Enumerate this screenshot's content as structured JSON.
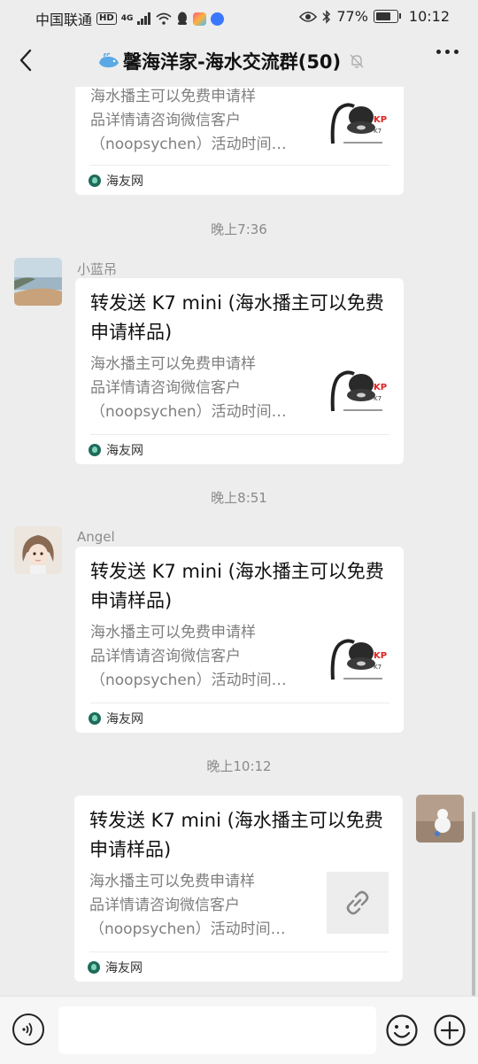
{
  "status_bar": {
    "carrier": "中国联通",
    "hd": "HD",
    "network": "4G",
    "battery": "77%",
    "time": "10:12"
  },
  "header": {
    "title": "馨海洋家-海水交流群(50)"
  },
  "messages": {
    "card0": {
      "desc_lines": [
        "海水播主可以免费申请样",
        "品详情请咨询微信客户",
        "（noopsychen）活动时间…"
      ],
      "source": "海友网"
    },
    "ts1": "晚上7:36",
    "msg1": {
      "sender": "小蓝吊",
      "title": "转发送 K7 mini (海水播主可以免费申请样品)",
      "desc_lines": [
        "海水播主可以免费申请样",
        "品详情请咨询微信客户",
        "（noopsychen）活动时间…"
      ],
      "source": "海友网"
    },
    "ts2": "晚上8:51",
    "msg2": {
      "sender": "Angel",
      "title": "转发送 K7 mini (海水播主可以免费申请样品)",
      "desc_lines": [
        "海水播主可以免费申请样",
        "品详情请咨询微信客户",
        "（noopsychen）活动时间…"
      ],
      "source": "海友网"
    },
    "ts3": "晚上10:12",
    "msg3": {
      "title": "转发送 K7 mini (海水播主可以免费申请样品)",
      "desc_lines": [
        "海水播主可以免费申请样",
        "品详情请咨询微信客户",
        "（noopsychen）活动时间…"
      ],
      "source": "海友网"
    }
  },
  "thumbnail": {
    "brand": "KP",
    "model": "K7",
    "model_sub": "mini"
  },
  "input": {
    "placeholder": ""
  },
  "icons": {
    "back": "chevron-left-icon",
    "mute": "bell-off-icon",
    "more": "more-dots-icon",
    "voice": "voice-icon",
    "emoji": "emoji-icon",
    "plus": "plus-circle-icon",
    "link": "link-icon"
  },
  "colors": {
    "background": "#ededed",
    "card": "#ffffff",
    "bottom_bar": "#f6f6f6"
  }
}
